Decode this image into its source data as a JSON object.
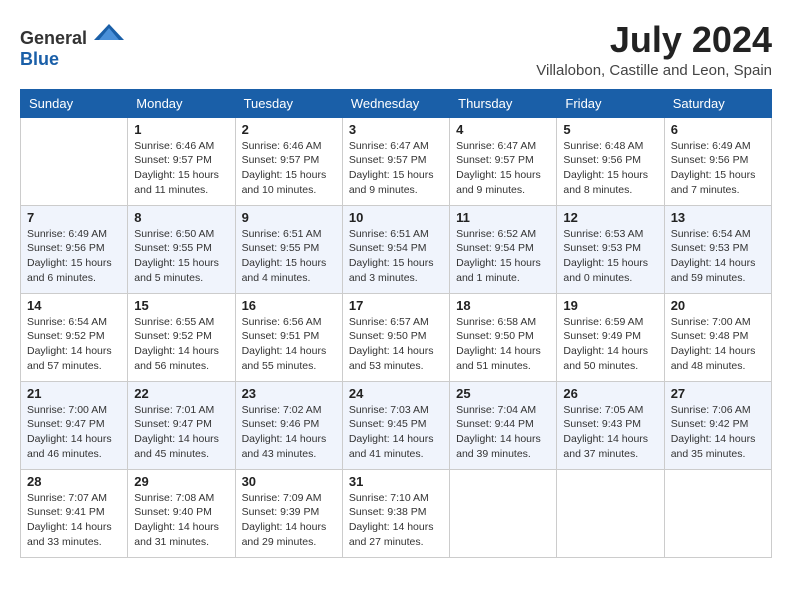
{
  "header": {
    "logo_general": "General",
    "logo_blue": "Blue",
    "month_year": "July 2024",
    "location": "Villalobon, Castille and Leon, Spain"
  },
  "weekdays": [
    "Sunday",
    "Monday",
    "Tuesday",
    "Wednesday",
    "Thursday",
    "Friday",
    "Saturday"
  ],
  "weeks": [
    [
      {
        "day": "",
        "info": ""
      },
      {
        "day": "1",
        "info": "Sunrise: 6:46 AM\nSunset: 9:57 PM\nDaylight: 15 hours\nand 11 minutes."
      },
      {
        "day": "2",
        "info": "Sunrise: 6:46 AM\nSunset: 9:57 PM\nDaylight: 15 hours\nand 10 minutes."
      },
      {
        "day": "3",
        "info": "Sunrise: 6:47 AM\nSunset: 9:57 PM\nDaylight: 15 hours\nand 9 minutes."
      },
      {
        "day": "4",
        "info": "Sunrise: 6:47 AM\nSunset: 9:57 PM\nDaylight: 15 hours\nand 9 minutes."
      },
      {
        "day": "5",
        "info": "Sunrise: 6:48 AM\nSunset: 9:56 PM\nDaylight: 15 hours\nand 8 minutes."
      },
      {
        "day": "6",
        "info": "Sunrise: 6:49 AM\nSunset: 9:56 PM\nDaylight: 15 hours\nand 7 minutes."
      }
    ],
    [
      {
        "day": "7",
        "info": "Sunrise: 6:49 AM\nSunset: 9:56 PM\nDaylight: 15 hours\nand 6 minutes."
      },
      {
        "day": "8",
        "info": "Sunrise: 6:50 AM\nSunset: 9:55 PM\nDaylight: 15 hours\nand 5 minutes."
      },
      {
        "day": "9",
        "info": "Sunrise: 6:51 AM\nSunset: 9:55 PM\nDaylight: 15 hours\nand 4 minutes."
      },
      {
        "day": "10",
        "info": "Sunrise: 6:51 AM\nSunset: 9:54 PM\nDaylight: 15 hours\nand 3 minutes."
      },
      {
        "day": "11",
        "info": "Sunrise: 6:52 AM\nSunset: 9:54 PM\nDaylight: 15 hours\nand 1 minute."
      },
      {
        "day": "12",
        "info": "Sunrise: 6:53 AM\nSunset: 9:53 PM\nDaylight: 15 hours\nand 0 minutes."
      },
      {
        "day": "13",
        "info": "Sunrise: 6:54 AM\nSunset: 9:53 PM\nDaylight: 14 hours\nand 59 minutes."
      }
    ],
    [
      {
        "day": "14",
        "info": "Sunrise: 6:54 AM\nSunset: 9:52 PM\nDaylight: 14 hours\nand 57 minutes."
      },
      {
        "day": "15",
        "info": "Sunrise: 6:55 AM\nSunset: 9:52 PM\nDaylight: 14 hours\nand 56 minutes."
      },
      {
        "day": "16",
        "info": "Sunrise: 6:56 AM\nSunset: 9:51 PM\nDaylight: 14 hours\nand 55 minutes."
      },
      {
        "day": "17",
        "info": "Sunrise: 6:57 AM\nSunset: 9:50 PM\nDaylight: 14 hours\nand 53 minutes."
      },
      {
        "day": "18",
        "info": "Sunrise: 6:58 AM\nSunset: 9:50 PM\nDaylight: 14 hours\nand 51 minutes."
      },
      {
        "day": "19",
        "info": "Sunrise: 6:59 AM\nSunset: 9:49 PM\nDaylight: 14 hours\nand 50 minutes."
      },
      {
        "day": "20",
        "info": "Sunrise: 7:00 AM\nSunset: 9:48 PM\nDaylight: 14 hours\nand 48 minutes."
      }
    ],
    [
      {
        "day": "21",
        "info": "Sunrise: 7:00 AM\nSunset: 9:47 PM\nDaylight: 14 hours\nand 46 minutes."
      },
      {
        "day": "22",
        "info": "Sunrise: 7:01 AM\nSunset: 9:47 PM\nDaylight: 14 hours\nand 45 minutes."
      },
      {
        "day": "23",
        "info": "Sunrise: 7:02 AM\nSunset: 9:46 PM\nDaylight: 14 hours\nand 43 minutes."
      },
      {
        "day": "24",
        "info": "Sunrise: 7:03 AM\nSunset: 9:45 PM\nDaylight: 14 hours\nand 41 minutes."
      },
      {
        "day": "25",
        "info": "Sunrise: 7:04 AM\nSunset: 9:44 PM\nDaylight: 14 hours\nand 39 minutes."
      },
      {
        "day": "26",
        "info": "Sunrise: 7:05 AM\nSunset: 9:43 PM\nDaylight: 14 hours\nand 37 minutes."
      },
      {
        "day": "27",
        "info": "Sunrise: 7:06 AM\nSunset: 9:42 PM\nDaylight: 14 hours\nand 35 minutes."
      }
    ],
    [
      {
        "day": "28",
        "info": "Sunrise: 7:07 AM\nSunset: 9:41 PM\nDaylight: 14 hours\nand 33 minutes."
      },
      {
        "day": "29",
        "info": "Sunrise: 7:08 AM\nSunset: 9:40 PM\nDaylight: 14 hours\nand 31 minutes."
      },
      {
        "day": "30",
        "info": "Sunrise: 7:09 AM\nSunset: 9:39 PM\nDaylight: 14 hours\nand 29 minutes."
      },
      {
        "day": "31",
        "info": "Sunrise: 7:10 AM\nSunset: 9:38 PM\nDaylight: 14 hours\nand 27 minutes."
      },
      {
        "day": "",
        "info": ""
      },
      {
        "day": "",
        "info": ""
      },
      {
        "day": "",
        "info": ""
      }
    ]
  ]
}
